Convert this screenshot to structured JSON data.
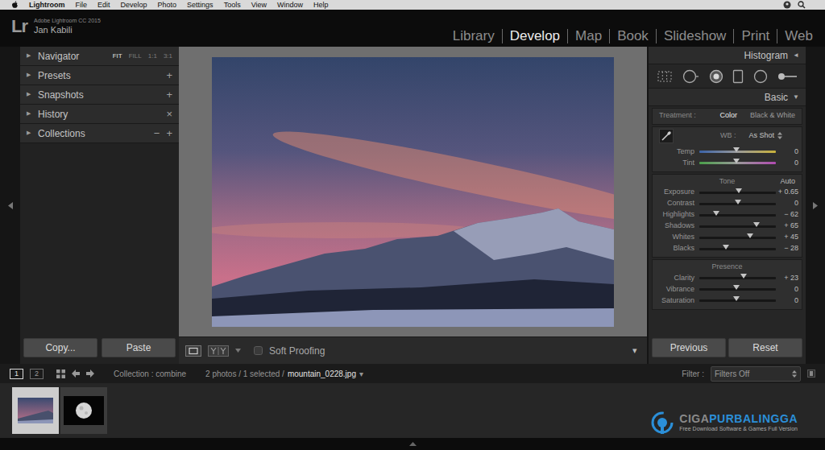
{
  "menu_bar": {
    "items": [
      "Lightroom",
      "File",
      "Edit",
      "Develop",
      "Photo",
      "Settings",
      "Tools",
      "View",
      "Window",
      "Help"
    ]
  },
  "identity_plate": {
    "logo": "Lr",
    "product": "Adobe Lightroom CC 2015",
    "user": "Jan Kabili"
  },
  "modules": [
    {
      "label": "Library",
      "selected": false
    },
    {
      "label": "Develop",
      "selected": true
    },
    {
      "label": "Map",
      "selected": false
    },
    {
      "label": "Book",
      "selected": false
    },
    {
      "label": "Slideshow",
      "selected": false
    },
    {
      "label": "Print",
      "selected": false
    },
    {
      "label": "Web",
      "selected": false
    }
  ],
  "left_panel": {
    "sections": [
      {
        "label": "Navigator",
        "toggle": "▶",
        "expanded": false,
        "controls": [
          {
            "label": "FIT",
            "selected": true
          },
          {
            "label": "FILL",
            "selected": false
          },
          {
            "label": "1:1",
            "selected": false
          },
          {
            "label": "3:1",
            "selected": false
          }
        ]
      },
      {
        "label": "Presets",
        "toggle": "▶",
        "expanded": false,
        "controls": [
          {
            "label": "+"
          }
        ]
      },
      {
        "label": "Snapshots",
        "toggle": "▶",
        "expanded": false,
        "controls": [
          {
            "label": "+"
          }
        ]
      },
      {
        "label": "History",
        "toggle": "▶",
        "expanded": false,
        "controls": [
          {
            "label": "×"
          }
        ]
      },
      {
        "label": "Collections",
        "toggle": "▶",
        "expanded": false,
        "controls": [
          {
            "label": "−"
          },
          {
            "label": "+"
          }
        ]
      }
    ],
    "buttons": [
      "Copy...",
      "Paste"
    ]
  },
  "toolbar": {
    "soft_proofing": {
      "label": "Soft Proofing",
      "checked": false
    },
    "menu": "▾"
  },
  "right_panel": {
    "histogram": {
      "label": "Histogram",
      "toggle": "◄"
    },
    "basic": {
      "label": "Basic",
      "toggle": "▼"
    },
    "treatment": {
      "label": "Treatment :",
      "options": [
        {
          "label": "Color",
          "selected": true
        },
        {
          "label": "Black & White",
          "selected": false
        }
      ]
    },
    "white_balance": {
      "label": "WB :",
      "value": "As Shot",
      "sliders": [
        {
          "label": "Temp",
          "reading": "0",
          "level": 0.48,
          "kind": "temperature"
        },
        {
          "label": "Tint",
          "reading": "0",
          "level": 0.48,
          "kind": "tint"
        }
      ]
    },
    "tone": {
      "label": "Tone",
      "auto": "Auto",
      "sliders": [
        {
          "label": "Exposure",
          "reading": "+ 0.65",
          "level": 0.52,
          "kind": "plain"
        },
        {
          "label": "Contrast",
          "reading": "0",
          "level": 0.5,
          "kind": "plain"
        },
        {
          "label": "Highlights",
          "reading": "− 62",
          "level": 0.22,
          "kind": "plain"
        },
        {
          "label": "Shadows",
          "reading": "+ 65",
          "level": 0.75,
          "kind": "plain"
        },
        {
          "label": "Whites",
          "reading": "+ 45",
          "level": 0.66,
          "kind": "plain"
        },
        {
          "label": "Blacks",
          "reading": "− 28",
          "level": 0.35,
          "kind": "plain"
        }
      ]
    },
    "presence": {
      "label": "Presence",
      "sliders": [
        {
          "label": "Clarity",
          "reading": "+ 23",
          "level": 0.58,
          "kind": "plain"
        },
        {
          "label": "Vibrance",
          "reading": "0",
          "level": 0.48,
          "kind": "plain"
        },
        {
          "label": "Saturation",
          "reading": "0",
          "level": 0.48,
          "kind": "plain"
        }
      ]
    },
    "buttons": [
      "Previous",
      "Reset"
    ]
  },
  "filmstrip_bar": {
    "views": [
      {
        "label": "1",
        "selected": true
      },
      {
        "label": "2",
        "selected": false
      }
    ],
    "source": "Collection : combine",
    "count": "2 photos / 1 selected /",
    "file": "mountain_0228.jpg",
    "file_menu": "▾",
    "filter_label": "Filter :",
    "filter_value": "Filters Off"
  },
  "filmstrip": {
    "thumbnails": [
      {
        "kind": "landscape",
        "selected": true
      },
      {
        "kind": "moon",
        "selected": false
      }
    ]
  },
  "watermark": {
    "brand_prefix": "CIGA",
    "brand_suffix": "PURBALINGGA",
    "tagline": "Free Download Software & Games Full Version"
  }
}
